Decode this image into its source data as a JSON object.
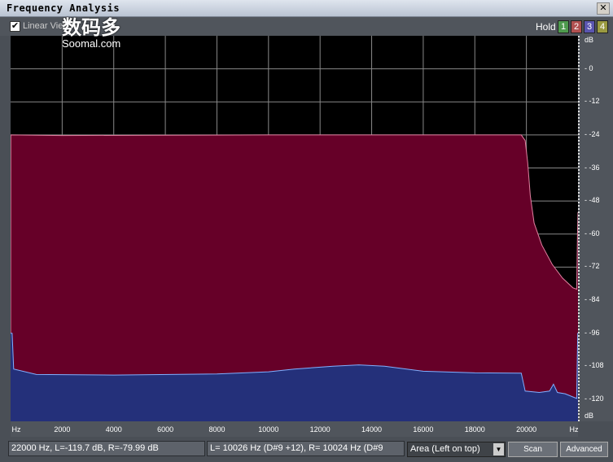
{
  "window": {
    "title": "Frequency Analysis",
    "close_icon": "close-icon"
  },
  "toolbar": {
    "linear_view_label": "Linear View",
    "linear_view_checked": true,
    "hold_label": "Hold",
    "hold_buttons": [
      {
        "label": "1",
        "color": "#4e9a4e"
      },
      {
        "label": "2",
        "color": "#b05050"
      },
      {
        "label": "3",
        "color": "#5a55b0"
      },
      {
        "label": "4",
        "color": "#9a9a40"
      }
    ]
  },
  "watermark": {
    "cn": "数码多",
    "en": "Soomal.com"
  },
  "chart_data": {
    "type": "area",
    "xlabel": "Hz",
    "ylabel": "dB",
    "xlim": [
      0,
      22000
    ],
    "ylim": [
      -128,
      12
    ],
    "x_ticks": [
      "Hz",
      "2000",
      "4000",
      "6000",
      "8000",
      "10000",
      "12000",
      "14000",
      "16000",
      "18000",
      "20000",
      "Hz"
    ],
    "y_ticks": [
      "dB",
      "0",
      "-12",
      "-24",
      "-36",
      "-48",
      "-60",
      "-72",
      "-84",
      "-96",
      "-108",
      "-120",
      "dB"
    ],
    "grid": true,
    "series": [
      {
        "color": "#660028",
        "line": "#e080a0",
        "points": [
          [
            0,
            -128
          ],
          [
            10,
            -24
          ],
          [
            2000,
            -24.2
          ],
          [
            6000,
            -24.1
          ],
          [
            10000,
            -24
          ],
          [
            14000,
            -24
          ],
          [
            18000,
            -24
          ],
          [
            19800,
            -24
          ],
          [
            19950,
            -26
          ],
          [
            20050,
            -34
          ],
          [
            20150,
            -46
          ],
          [
            20300,
            -56
          ],
          [
            20600,
            -64
          ],
          [
            21000,
            -71
          ],
          [
            21400,
            -76
          ],
          [
            21800,
            -79.5
          ],
          [
            21950,
            -80
          ],
          [
            21980,
            -60
          ],
          [
            22000,
            -52
          ]
        ]
      },
      {
        "color": "#24307a",
        "line": "#80b0ff",
        "points": [
          [
            0,
            -96
          ],
          [
            60,
            -96
          ],
          [
            120,
            -109
          ],
          [
            1000,
            -111
          ],
          [
            4000,
            -111.2
          ],
          [
            8000,
            -110.8
          ],
          [
            10000,
            -110
          ],
          [
            11000,
            -109
          ],
          [
            12500,
            -108
          ],
          [
            13500,
            -107.5
          ],
          [
            14500,
            -108
          ],
          [
            16000,
            -109.8
          ],
          [
            18000,
            -110.4
          ],
          [
            19800,
            -110.5
          ],
          [
            19950,
            -117
          ],
          [
            20500,
            -117.5
          ],
          [
            20900,
            -117
          ],
          [
            21050,
            -114.5
          ],
          [
            21200,
            -117.5
          ],
          [
            21500,
            -118
          ],
          [
            21950,
            -119.7
          ],
          [
            21970,
            -108
          ],
          [
            21990,
            -96
          ],
          [
            22000,
            -96
          ]
        ]
      }
    ]
  },
  "status": {
    "cursor": "22000 Hz, L=-119.7 dB, R=-79.99 dB",
    "peak": "L=  10026 Hz (D#9 +12), R=  10024 Hz (D#9",
    "mode": "Area (Left on top)",
    "scan": "Scan",
    "advanced": "Advanced"
  }
}
